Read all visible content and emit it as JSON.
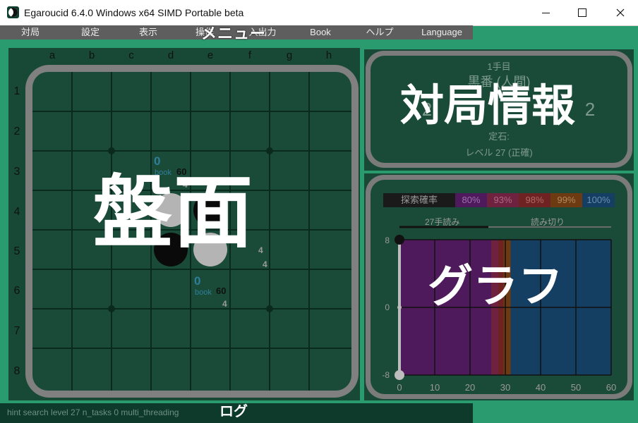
{
  "window": {
    "title": "Egaroucid 6.4.0 Windows x64 SIMD Portable beta",
    "minimize_icon": "minimize-icon",
    "maximize_icon": "maximize-icon",
    "close_icon": "close-icon"
  },
  "menu": {
    "overlay_label": "メニュー",
    "items": [
      {
        "label": "対局"
      },
      {
        "label": "設定"
      },
      {
        "label": "表示"
      },
      {
        "label": "操作"
      },
      {
        "label": "入出力"
      },
      {
        "label": "Book"
      },
      {
        "label": "ヘルプ"
      },
      {
        "label": "Language"
      }
    ]
  },
  "board": {
    "overlay_label": "盤面",
    "columns": [
      "a",
      "b",
      "c",
      "d",
      "e",
      "f",
      "g",
      "h"
    ],
    "rows": [
      "1",
      "2",
      "3",
      "4",
      "5",
      "6",
      "7",
      "8"
    ],
    "hints": [
      {
        "score": "0",
        "book": "book",
        "value": "60",
        "sub": "4"
      },
      {
        "score": "0",
        "book": "book",
        "value": "60",
        "sub": "4"
      }
    ],
    "extra_digits": [
      "4",
      "4",
      "4"
    ]
  },
  "info": {
    "overlay_label": "対局情報",
    "move_number": "1手目",
    "turn": "黒番 (人間)",
    "stone_count_left": "2",
    "stone_count_right": "2",
    "opening_label": "定石:",
    "level": "レベル 27 (正確)"
  },
  "graph": {
    "overlay_label": "グラフ",
    "legend": [
      {
        "label": "探索確率",
        "color": "#1a1a1a",
        "text_color": "#9a9a9a"
      },
      {
        "label": "80%",
        "color": "#4e1a5c",
        "text_color": "#a070b0"
      },
      {
        "label": "93%",
        "color": "#6e2240",
        "text_color": "#b06a84"
      },
      {
        "label": "98%",
        "color": "#6e2222",
        "text_color": "#b06a6a"
      },
      {
        "label": "99%",
        "color": "#6e3a12",
        "text_color": "#b08a5a"
      },
      {
        "label": "100%",
        "color": "#153e63",
        "text_color": "#6a8fb0"
      }
    ],
    "tabs": [
      {
        "label": "27手読み"
      },
      {
        "label": "読み切り"
      }
    ],
    "y_labels": [
      "8",
      "0",
      "-8"
    ],
    "x_labels": [
      "0",
      "10",
      "20",
      "30",
      "40",
      "50",
      "60"
    ]
  },
  "chart_data": {
    "type": "area",
    "x_range": [
      0,
      60
    ],
    "y_range": [
      -8,
      8
    ],
    "x_ticks": [
      0,
      10,
      20,
      30,
      40,
      50,
      60
    ],
    "y_ticks": [
      8,
      0,
      -8
    ],
    "bands": [
      {
        "level": "80%",
        "from": 0,
        "to": 26,
        "color": "#4e1a5c"
      },
      {
        "level": "93%",
        "from": 26,
        "to": 28,
        "color": "#6e2240"
      },
      {
        "level": "98%",
        "from": 28,
        "to": 29.5,
        "color": "#6e2222"
      },
      {
        "level": "99%",
        "from": 29.5,
        "to": 31.5,
        "color": "#6e3a12"
      },
      {
        "level": "100%",
        "from": 31.5,
        "to": 60,
        "color": "#153e63"
      }
    ],
    "points": [
      {
        "x": 0,
        "y": 8
      },
      {
        "x": 0,
        "y": -8
      }
    ],
    "grid": true
  },
  "log": {
    "text": "hint search level 27 n_tasks 0 multi_threading",
    "overlay_label": "ログ"
  }
}
